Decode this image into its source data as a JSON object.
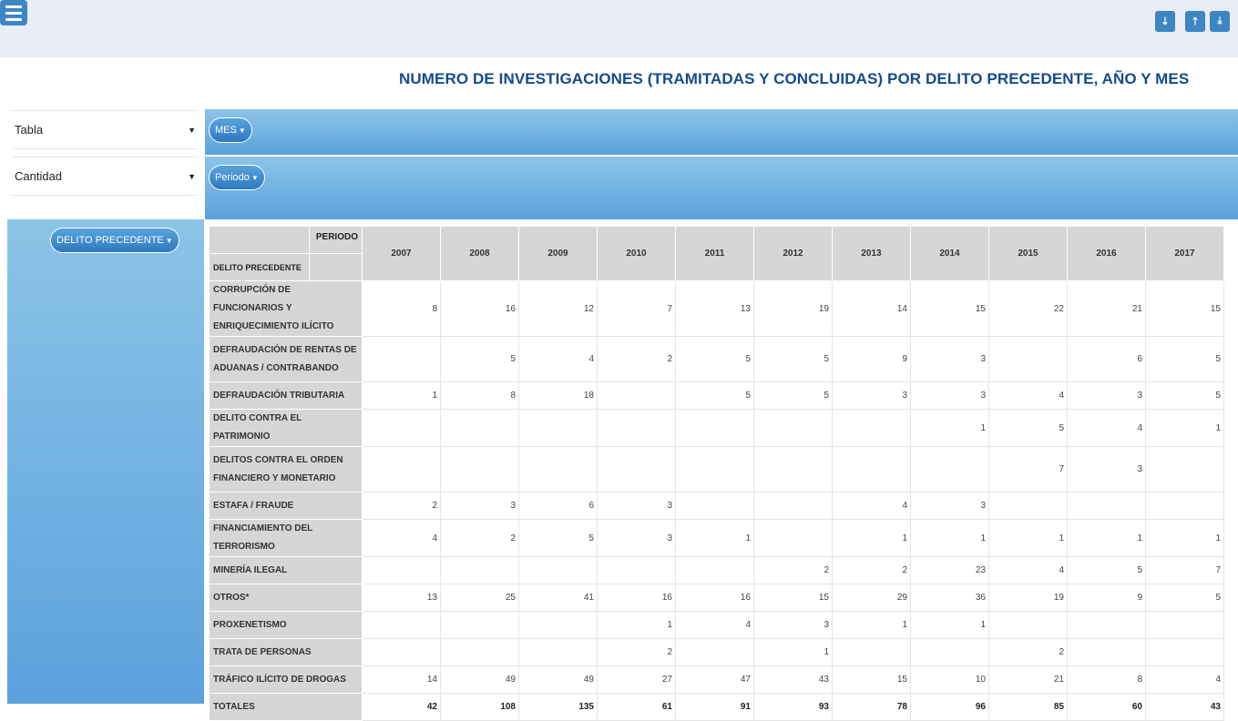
{
  "toolbar": {
    "tools": [
      "sort-asc-icon",
      "sort-desc-icon",
      "download-icon"
    ]
  },
  "title": "NUMERO DE INVESTIGACIONES (TRAMITADAS Y CONCLUIDAS) POR DELITO PRECEDENTE, AÑO Y MES",
  "controls": {
    "renderer": {
      "value": "Tabla"
    },
    "aggregator": {
      "value": "Cantidad"
    }
  },
  "pills": {
    "mes": "MES",
    "periodo": "Periodo",
    "delito": "DELITO PRECEDENTE"
  },
  "table": {
    "col_header_label": "PERIODO",
    "row_header_label": "DELITO PRECEDENTE",
    "years": [
      "2007",
      "2008",
      "2009",
      "2010",
      "2011",
      "2012",
      "2013",
      "2014",
      "2015",
      "2016",
      "2017"
    ],
    "rows": [
      {
        "label": "CORRUPCIÓN DE FUNCIONARIOS Y ENRIQUECIMIENTO ILÍCITO",
        "values": [
          "8",
          "16",
          "12",
          "7",
          "13",
          "19",
          "14",
          "15",
          "22",
          "21",
          "15"
        ]
      },
      {
        "label": "DEFRAUDACIÓN DE RENTAS DE ADUANAS / CONTRABANDO",
        "values": [
          "",
          "5",
          "4",
          "2",
          "5",
          "5",
          "9",
          "3",
          "",
          "6",
          "5"
        ]
      },
      {
        "label": "DEFRAUDACIÓN TRIBUTARIA",
        "values": [
          "1",
          "8",
          "18",
          "",
          "5",
          "5",
          "3",
          "3",
          "4",
          "3",
          "5"
        ]
      },
      {
        "label": "DELITO CONTRA EL PATRIMONIO",
        "values": [
          "",
          "",
          "",
          "",
          "",
          "",
          "",
          "1",
          "5",
          "4",
          "1"
        ]
      },
      {
        "label": "DELITOS CONTRA EL ORDEN FINANCIERO Y MONETARIO",
        "values": [
          "",
          "",
          "",
          "",
          "",
          "",
          "",
          "",
          "7",
          "3",
          ""
        ]
      },
      {
        "label": "ESTAFA / FRAUDE",
        "values": [
          "2",
          "3",
          "6",
          "3",
          "",
          "",
          "4",
          "3",
          "",
          "",
          ""
        ]
      },
      {
        "label": "FINANCIAMIENTO DEL TERRORISMO",
        "values": [
          "4",
          "2",
          "5",
          "3",
          "1",
          "",
          "1",
          "1",
          "1",
          "1",
          "1"
        ]
      },
      {
        "label": "MINERÍA ILEGAL",
        "values": [
          "",
          "",
          "",
          "",
          "",
          "2",
          "2",
          "23",
          "4",
          "5",
          "7"
        ]
      },
      {
        "label": "OTROS*",
        "values": [
          "13",
          "25",
          "41",
          "16",
          "16",
          "15",
          "29",
          "36",
          "19",
          "9",
          "5"
        ]
      },
      {
        "label": "PROXENETISMO",
        "values": [
          "",
          "",
          "",
          "1",
          "4",
          "3",
          "1",
          "1",
          "",
          "",
          ""
        ]
      },
      {
        "label": "TRATA DE PERSONAS",
        "values": [
          "",
          "",
          "",
          "2",
          "",
          "1",
          "",
          "",
          "2",
          "",
          ""
        ]
      },
      {
        "label": "TRÁFICO ILÍCITO DE DROGAS",
        "values": [
          "14",
          "49",
          "49",
          "27",
          "47",
          "43",
          "15",
          "10",
          "21",
          "8",
          "4"
        ]
      }
    ],
    "totals": {
      "label": "TOTALES",
      "values": [
        "42",
        "108",
        "135",
        "61",
        "91",
        "93",
        "78",
        "96",
        "85",
        "60",
        "43"
      ]
    }
  }
}
